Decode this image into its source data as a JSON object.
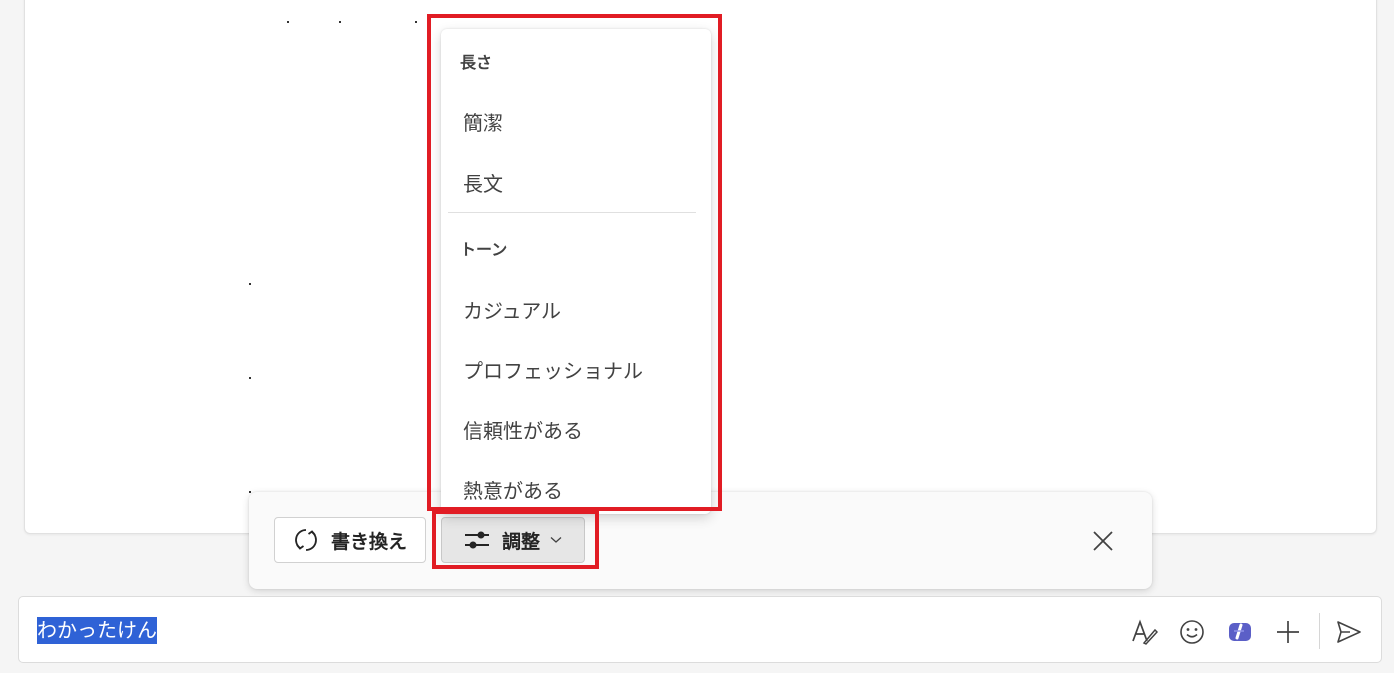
{
  "adjust_menu": {
    "length_header": "長さ",
    "length_items": [
      "簡潔",
      "長文"
    ],
    "tone_header": "トーン",
    "tone_items": [
      "カジュアル",
      "プロフェッショナル",
      "信頼性がある",
      "熱意がある"
    ]
  },
  "toolbar": {
    "rewrite_label": "書き換え",
    "adjust_label": "調整"
  },
  "compose": {
    "text": "わかったけん"
  },
  "icons": {
    "rewrite": "refresh-icon",
    "adjust": "sliders-icon",
    "adjust_chevron": "chevron-down-icon",
    "close": "close-icon",
    "format": "format-text-icon",
    "emoji": "emoji-icon",
    "copilot": "copilot-icon",
    "add": "plus-icon",
    "send": "send-icon"
  },
  "colors": {
    "highlight": "#e11c24",
    "selection": "#2f62d6",
    "copilot": "#5b5fc7"
  }
}
